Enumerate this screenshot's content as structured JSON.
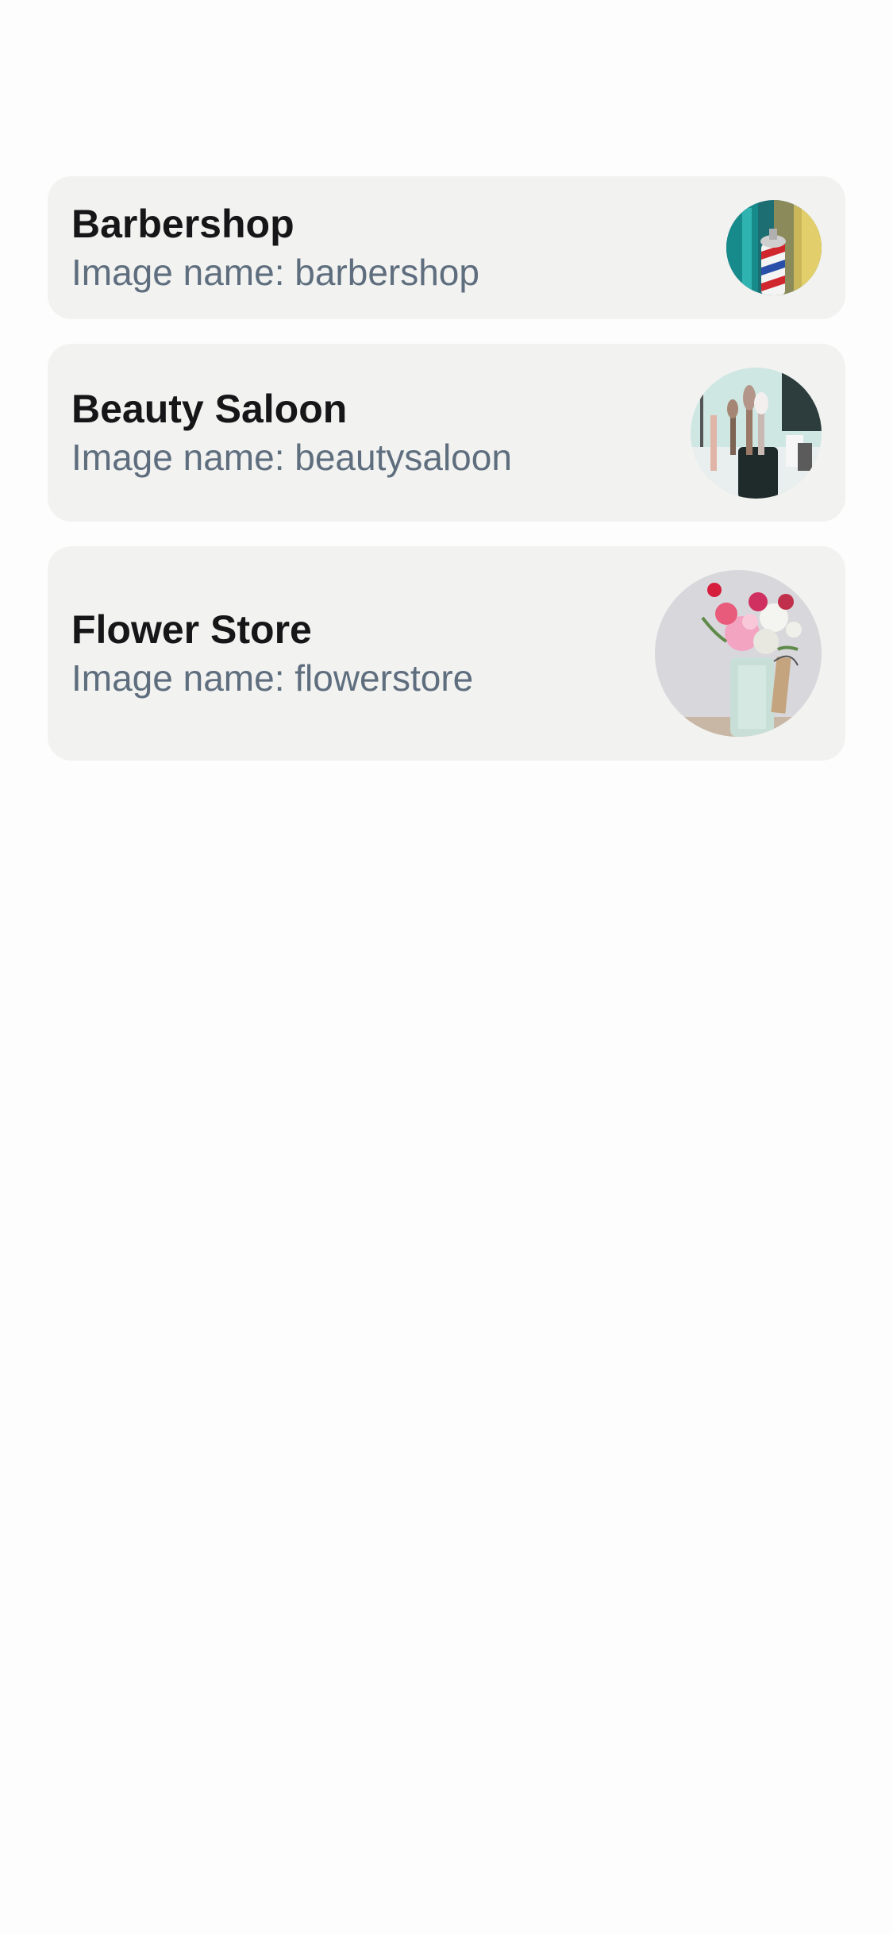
{
  "stores": [
    {
      "title": "Barbershop",
      "subtitle": "Image name: barbershop",
      "thumbnail_icon": "barbershop-photo"
    },
    {
      "title": "Beauty Saloon",
      "subtitle": "Image name: beautysaloon",
      "thumbnail_icon": "beautysaloon-photo"
    },
    {
      "title": "Flower Store",
      "subtitle": "Image name: flowerstore",
      "thumbnail_icon": "flowerstore-photo"
    }
  ],
  "colors": {
    "background": "#fdfdfd",
    "card": "#f2f2f0",
    "title": "#161618",
    "subtitle": "#5e6e7e"
  }
}
